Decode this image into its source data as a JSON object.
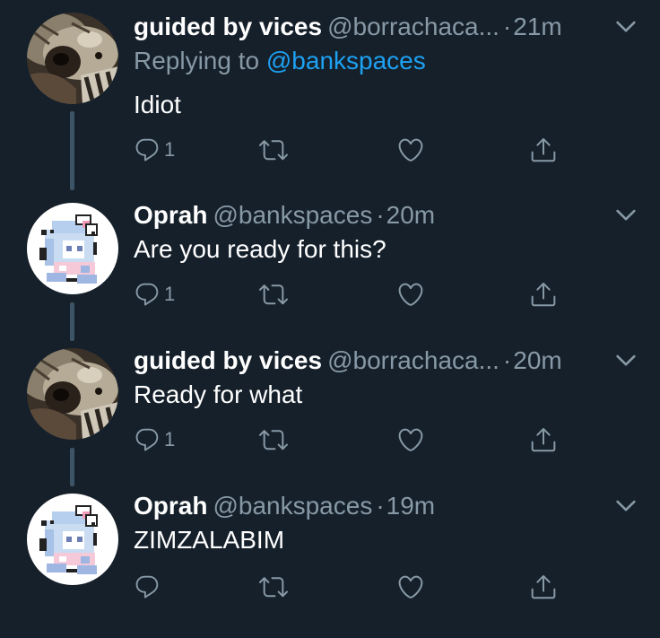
{
  "tweets": [
    {
      "name": "guided by vices",
      "handle": "@borrachaca...",
      "sep": "·",
      "time": "21m",
      "reply_prefix": "Replying to ",
      "reply_mention": "@bankspaces",
      "text": "Idiot",
      "reply_count": "1",
      "avatar": "hyena-avatar"
    },
    {
      "name": "Oprah",
      "handle": "@bankspaces",
      "sep": "·",
      "time": "20m",
      "text": "Are you ready for this?",
      "reply_count": "1",
      "avatar": "pixel-anime-avatar"
    },
    {
      "name": "guided by vices",
      "handle": "@borrachaca...",
      "sep": "·",
      "time": "20m",
      "text": "Ready for what",
      "reply_count": "1",
      "avatar": "hyena-avatar"
    },
    {
      "name": "Oprah",
      "handle": "@bankspaces",
      "sep": "·",
      "time": "19m",
      "text": "ZIMZALABIM",
      "reply_count": "",
      "avatar": "pixel-anime-avatar"
    }
  ],
  "icons": {
    "reply": "reply-icon",
    "retweet": "retweet-icon",
    "like": "heart-icon",
    "share": "share-icon",
    "caret": "chevron-down-icon"
  },
  "colors": {
    "background": "#15202b",
    "text": "#ffffff",
    "secondary": "#8899a6",
    "link": "#1da1f2",
    "thread_line": "#3d5466"
  }
}
